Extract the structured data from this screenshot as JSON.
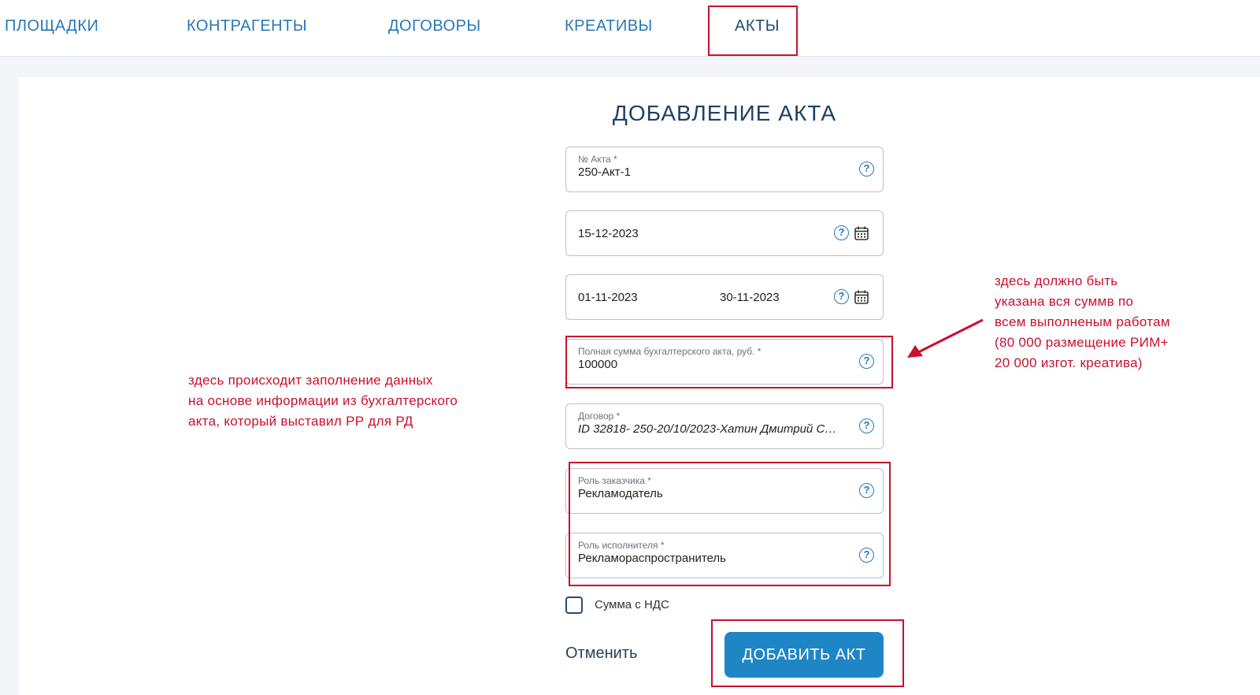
{
  "nav": {
    "tabs": [
      "ПЛОЩАДКИ",
      "КОНТРАГЕНТЫ",
      "ДОГОВОРЫ",
      "КРЕАТИВЫ",
      "АКТЫ"
    ],
    "active": "АКТЫ"
  },
  "form": {
    "title": "ДОБАВЛЕНИЕ АКТА",
    "act_number": {
      "label": "№ Акта *",
      "value": "250-Акт-1"
    },
    "act_date": {
      "value": "15-12-2023"
    },
    "period": {
      "start": "01-11-2023",
      "end": "30-11-2023"
    },
    "amount": {
      "label": "Полная сумма бухгалтерского акта, руб. *",
      "value": "100000"
    },
    "contract": {
      "label": "Договор *",
      "value": "ID 32818- 250-20/10/2023-Хатин Дмитрий Степа..."
    },
    "customer_role": {
      "label": "Роль заказчика *",
      "value": "Рекламодатель"
    },
    "executor_role": {
      "label": "Роль исполнителя *",
      "value": "Рекламораспространитель"
    },
    "vat_checkbox": {
      "label": "Сумма с НДС",
      "checked": false
    },
    "cancel_label": "Отменить",
    "submit_label": "ДОБАВИТЬ АКТ"
  },
  "annotations": {
    "left_note": [
      "здесь происходит заполнение данных",
      "на основе информации из бухгалтерского",
      "акта, который выставил РР для РД"
    ],
    "right_note": [
      "здесь должно быть",
      "указана вся суммв по",
      "всем выполненым работам",
      "(80 000 размещение РИМ+",
      "20 000 изгот. креатива)"
    ],
    "color": "#c8102e"
  },
  "icons": {
    "help": "?",
    "help_icon": "question-circle-icon",
    "calendar_icon": "calendar-icon"
  }
}
